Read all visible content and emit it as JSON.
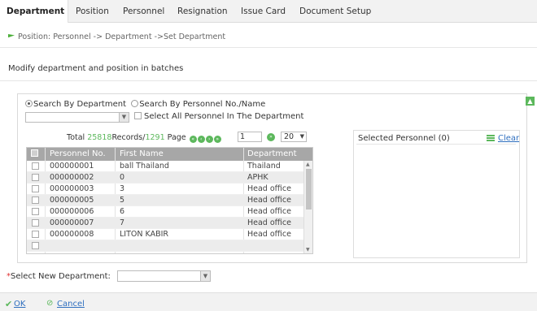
{
  "tabs": [
    "Department",
    "Position",
    "Personnel",
    "Resignation",
    "Issue Card",
    "Document Setup"
  ],
  "breadcrumb": "Position: Personnel -> Department ->Set Department",
  "subtitle": "Modify department and position in batches",
  "filter": {
    "radio_dept": "Search By Department",
    "radio_personnel": "Search By Personnel No./Name",
    "select_all": "Select All Personnel In The Department"
  },
  "pager": {
    "total_label": "Total",
    "records": "25818",
    "records_label": "Records/",
    "pages": "1291",
    "page_label": "Page",
    "current_page": "1",
    "page_size": "20"
  },
  "grid": {
    "headers": [
      "Personnel No.",
      "First Name",
      "Department"
    ],
    "rows": [
      {
        "no": "000000001",
        "name": "ball Thailand",
        "dept": "Thailand"
      },
      {
        "no": "000000002",
        "name": "0",
        "dept": "APHK"
      },
      {
        "no": "000000003",
        "name": "3",
        "dept": "Head office"
      },
      {
        "no": "000000005",
        "name": "5",
        "dept": "Head office"
      },
      {
        "no": "000000006",
        "name": "6",
        "dept": "Head office"
      },
      {
        "no": "000000007",
        "name": "7",
        "dept": "Head office"
      },
      {
        "no": "000000008",
        "name": "LITON KABIR",
        "dept": "Head office"
      }
    ]
  },
  "selected": {
    "title": "Selected Personnel (0)",
    "clear": "Clear"
  },
  "new_department": {
    "required_mark": "*",
    "label": "Select New Department:"
  },
  "footer": {
    "ok": "OK",
    "cancel": "Cancel"
  },
  "colors": {
    "accent_green": "#5cb85c",
    "link_blue": "#2f6fbf",
    "header_gray": "#a7a7a7"
  }
}
